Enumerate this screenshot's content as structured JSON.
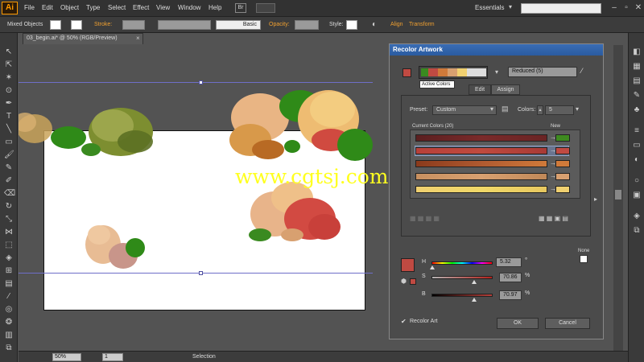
{
  "menubar": {
    "logo": "Ai",
    "items": [
      "File",
      "Edit",
      "Object",
      "Type",
      "Select",
      "Effect",
      "View",
      "Window",
      "Help"
    ],
    "bridge": "Br",
    "workspace": "Essentials",
    "window_controls": [
      "–",
      "▫",
      "✕"
    ]
  },
  "controlbar": {
    "selection_type": "Mixed Objects",
    "stroke_label": "Stroke:",
    "stroke_style": "Basic",
    "opacity_label": "Opacity:",
    "style_label": "Style:",
    "align_label": "Align",
    "transform_label": "Transform"
  },
  "document": {
    "tab_title": "03_begin.ai* @ 50% (RGB/Preview)",
    "watermark": "www.cgtsj.com"
  },
  "statusbar": {
    "zoom": "50%",
    "artboard": "1",
    "tool": "Selection"
  },
  "dialog": {
    "title": "Recolor Artwork",
    "active_colors_tooltip": "Active Colors",
    "preset_name": "Reduced (5)",
    "tabs": [
      "Edit",
      "Assign"
    ],
    "preset_label": "Preset:",
    "preset_value": "Custom",
    "colors_label": "Colors:",
    "colors_value": "5",
    "current_colors_label": "Current Colors (20)",
    "new_label": "New",
    "none_label": "None",
    "h_label": "H",
    "h_value": "5.32",
    "h_unit": "°",
    "s_label": "S",
    "s_value": "70.86",
    "s_unit": "%",
    "b_label": "B",
    "b_value": "70.97",
    "b_unit": "%",
    "recolor_art_label": "Recolor Art",
    "recolor_checked": true,
    "ok_label": "OK",
    "cancel_label": "Cancel"
  },
  "colors": {
    "accent": "#ff9a00",
    "title_bar": "#2a5ba0",
    "rows": [
      {
        "current": [
          "#5a1f20",
          "#7a2a2a",
          "#6a2424"
        ],
        "new": "#3e8a20"
      },
      {
        "current": [
          "#b8403a",
          "#c04a3e",
          "#a83a36"
        ],
        "new": "#c04a42"
      },
      {
        "current": [
          "#8a3a1c",
          "#b05a30",
          "#d07a3a"
        ],
        "new": "#d07a3a"
      },
      {
        "current": [
          "#c89060",
          "#d8a070",
          "#c08858"
        ],
        "new": "#d8a070"
      },
      {
        "current": [
          "#f0d070",
          "#f0d868",
          "#e8c860"
        ],
        "new": "#f0d070"
      }
    ],
    "active_strip": [
      "#3a8a20",
      "#c04a42",
      "#d07a3a",
      "#d8a070",
      "#f0d070"
    ],
    "selected_color": "#c04a42"
  }
}
